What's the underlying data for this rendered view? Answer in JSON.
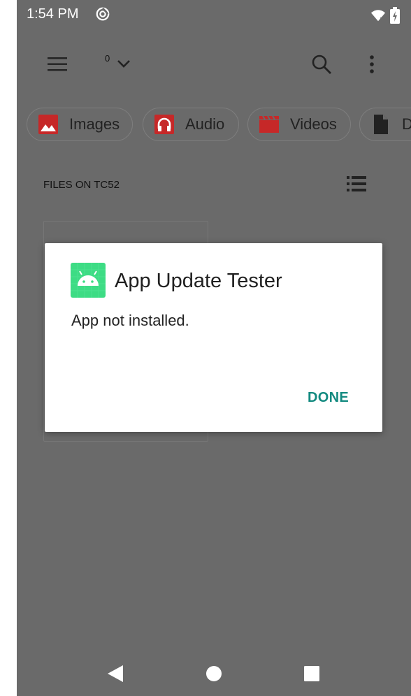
{
  "status_bar": {
    "time": "1:54 PM",
    "icons": [
      "sync-icon",
      "wifi-icon",
      "battery-charging-icon"
    ]
  },
  "toolbar": {
    "selected_count": "0",
    "icons": [
      "menu-icon",
      "chevron-down-icon",
      "search-icon",
      "more-vert-icon"
    ]
  },
  "chips": [
    {
      "label": "Images",
      "icon": "image-icon",
      "color": "#c62828"
    },
    {
      "label": "Audio",
      "icon": "headphones-icon",
      "color": "#c62828"
    },
    {
      "label": "Videos",
      "icon": "clapperboard-icon",
      "color": "#c62828"
    },
    {
      "label": "D",
      "icon": "document-icon",
      "color": "#222222"
    }
  ],
  "section": {
    "title": "FILES ON TC52",
    "icon": "list-view-icon"
  },
  "dialog": {
    "app_name": "App Update Tester",
    "message": "App not installed.",
    "done_label": "DONE",
    "app_icon": "android-icon",
    "app_icon_color": "#3ddc84",
    "accent_color": "#138a80"
  },
  "nav_bar": {
    "icons": [
      "back-icon",
      "home-icon",
      "recents-icon"
    ]
  }
}
